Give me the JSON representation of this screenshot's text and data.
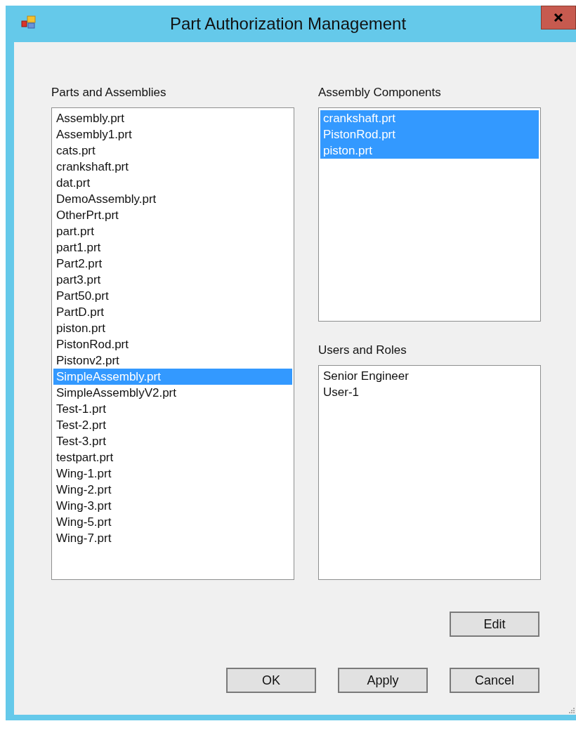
{
  "window": {
    "title": "Part Authorization Management"
  },
  "parts": {
    "label": "Parts and Assemblies",
    "items": [
      {
        "text": "Assembly.prt",
        "selected": false
      },
      {
        "text": "Assembly1.prt",
        "selected": false
      },
      {
        "text": "cats.prt",
        "selected": false
      },
      {
        "text": "crankshaft.prt",
        "selected": false
      },
      {
        "text": "dat.prt",
        "selected": false
      },
      {
        "text": "DemoAssembly.prt",
        "selected": false
      },
      {
        "text": "OtherPrt.prt",
        "selected": false
      },
      {
        "text": "part.prt",
        "selected": false
      },
      {
        "text": "part1.prt",
        "selected": false
      },
      {
        "text": "Part2.prt",
        "selected": false
      },
      {
        "text": "part3.prt",
        "selected": false
      },
      {
        "text": "Part50.prt",
        "selected": false
      },
      {
        "text": "PartD.prt",
        "selected": false
      },
      {
        "text": "piston.prt",
        "selected": false
      },
      {
        "text": "PistonRod.prt",
        "selected": false
      },
      {
        "text": "Pistonv2.prt",
        "selected": false
      },
      {
        "text": "SimpleAssembly.prt",
        "selected": true
      },
      {
        "text": "SimpleAssemblyV2.prt",
        "selected": false
      },
      {
        "text": "Test-1.prt",
        "selected": false
      },
      {
        "text": "Test-2.prt",
        "selected": false
      },
      {
        "text": "Test-3.prt",
        "selected": false
      },
      {
        "text": "testpart.prt",
        "selected": false
      },
      {
        "text": "Wing-1.prt",
        "selected": false
      },
      {
        "text": "Wing-2.prt",
        "selected": false
      },
      {
        "text": "Wing-3.prt",
        "selected": false
      },
      {
        "text": "Wing-5.prt",
        "selected": false
      },
      {
        "text": "Wing-7.prt",
        "selected": false
      }
    ]
  },
  "components": {
    "label": "Assembly Components",
    "items": [
      {
        "text": "crankshaft.prt",
        "selected": true
      },
      {
        "text": "PistonRod.prt",
        "selected": true
      },
      {
        "text": "piston.prt",
        "selected": true
      }
    ]
  },
  "users": {
    "label": "Users and Roles",
    "items": [
      {
        "text": "Senior Engineer",
        "selected": false
      },
      {
        "text": "User-1",
        "selected": false
      }
    ]
  },
  "edit_button": "Edit",
  "buttons": [
    "OK",
    "Apply",
    "Cancel"
  ]
}
